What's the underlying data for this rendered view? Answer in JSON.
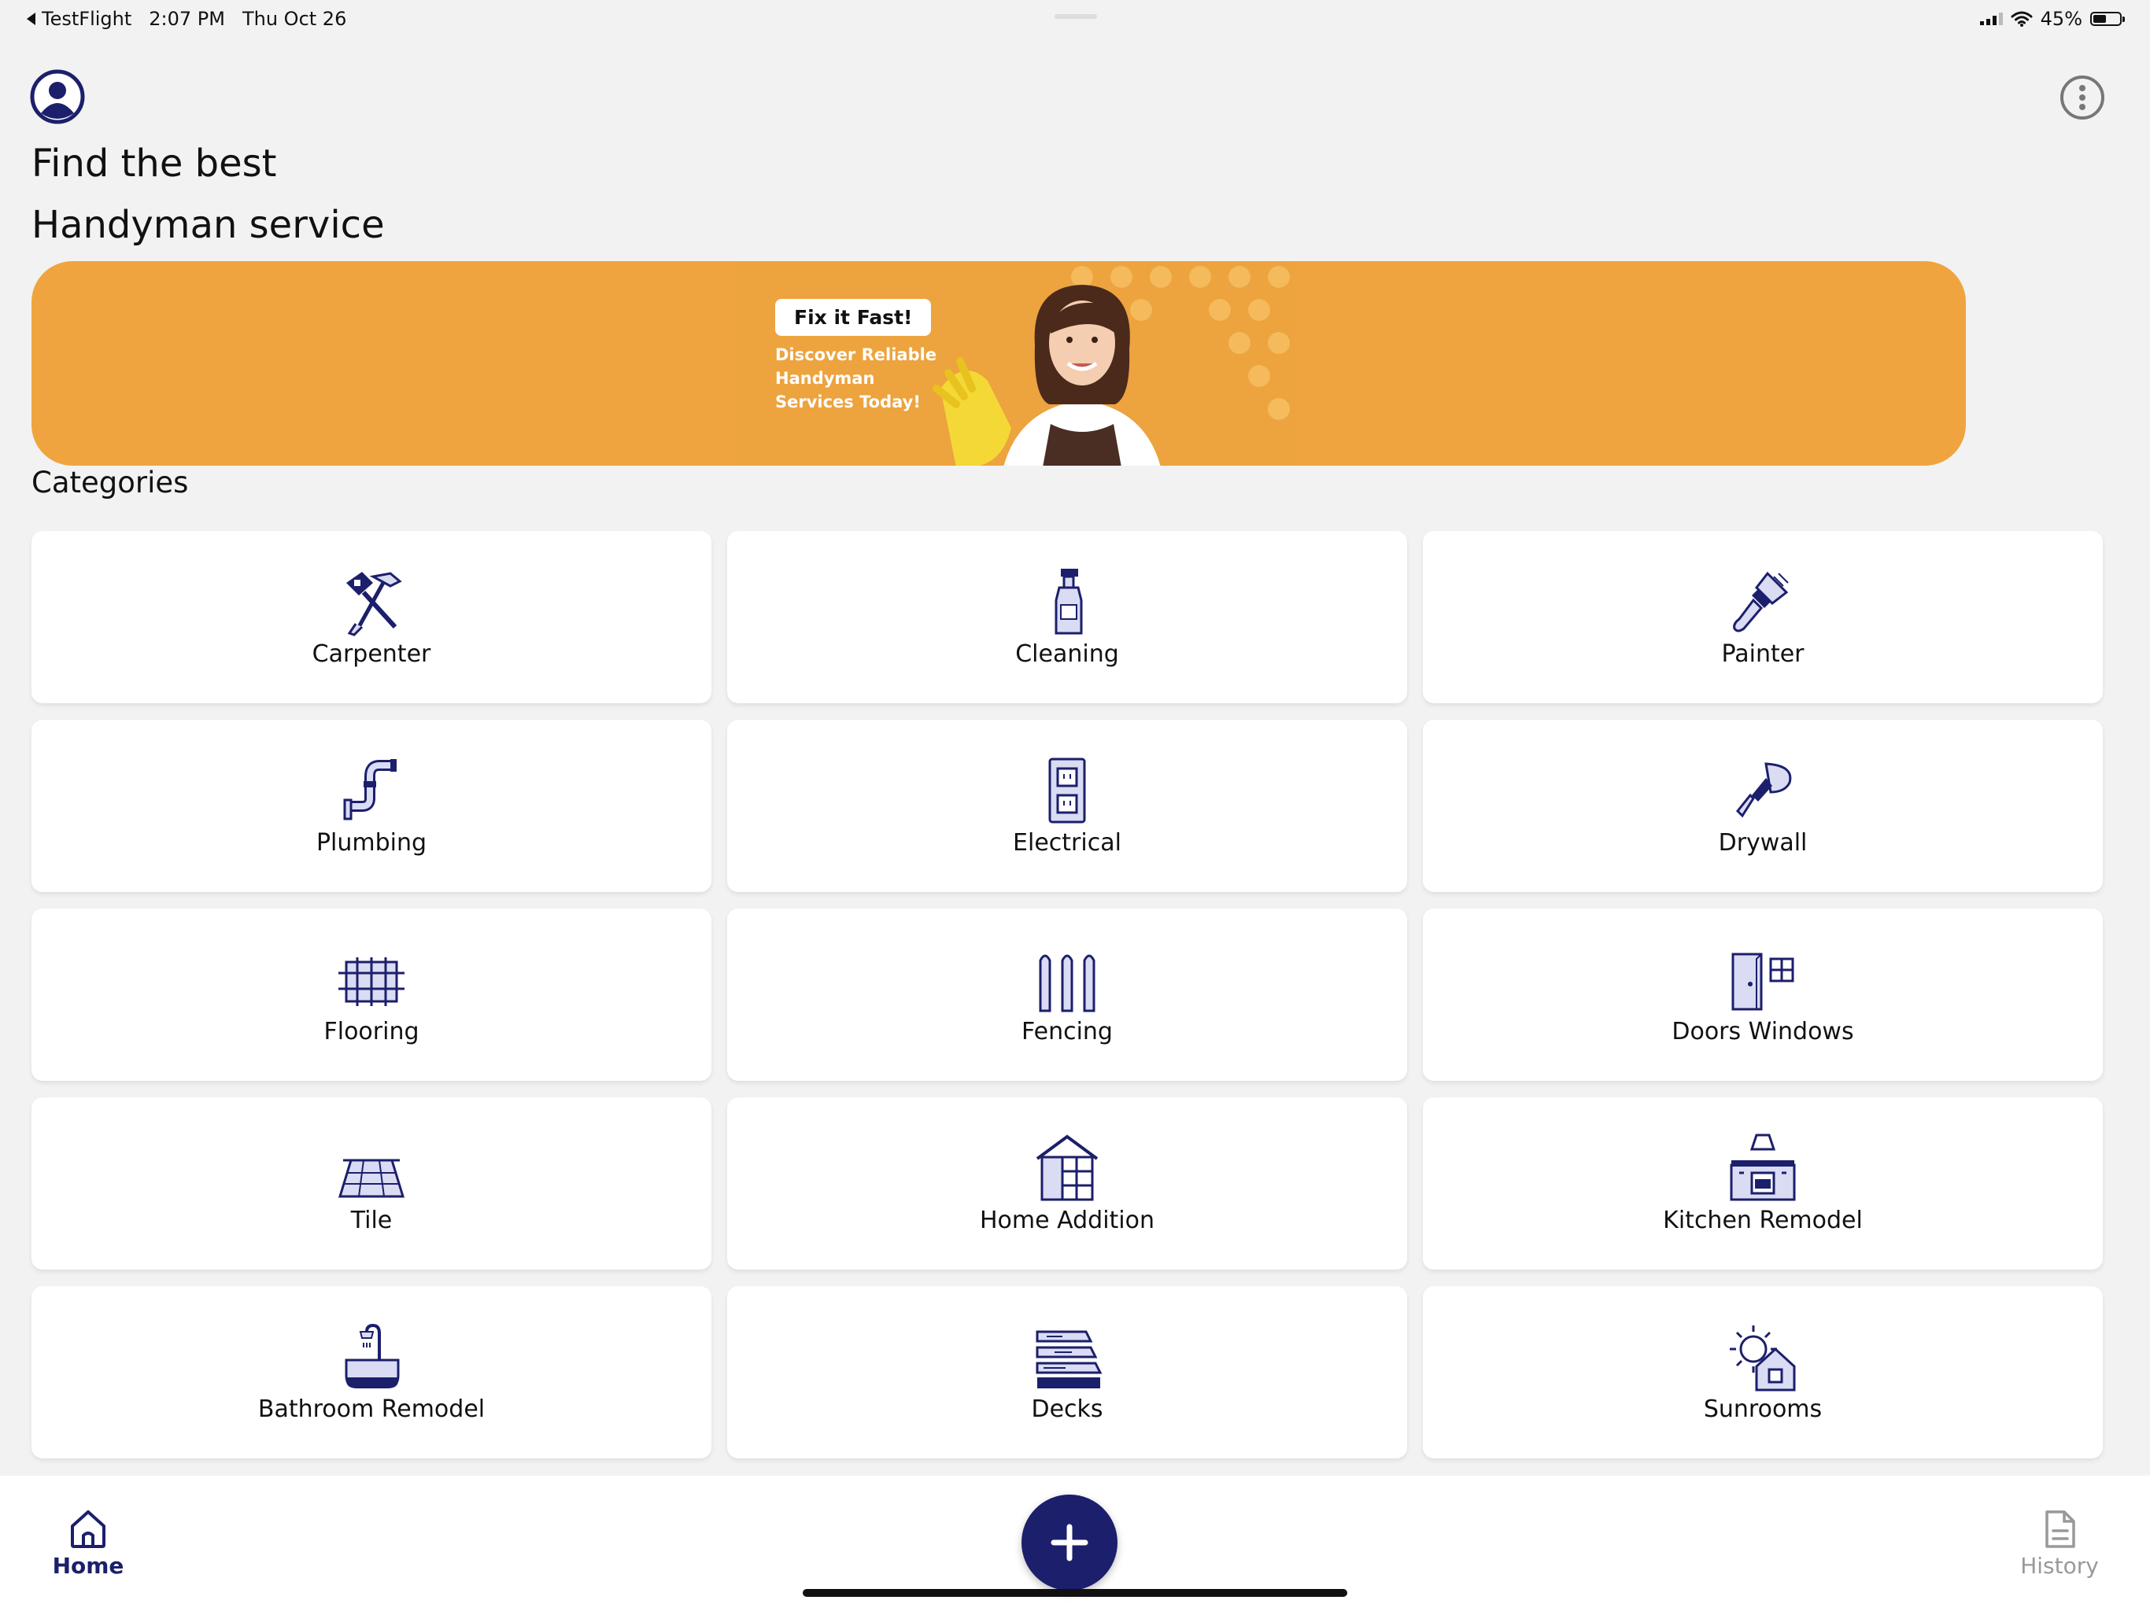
{
  "status_bar": {
    "back_app": "TestFlight",
    "time": "2:07 PM",
    "date": "Thu Oct 26",
    "battery": "45%"
  },
  "header": {
    "line1": "Find the best",
    "line2": "Handyman service"
  },
  "banner": {
    "pill": "Fix it Fast!",
    "subtitle": "Discover Reliable Handyman Services Today!"
  },
  "categories": {
    "title": "Categories",
    "items": [
      {
        "label": "Carpenter",
        "icon": "carpenter-icon"
      },
      {
        "label": "Cleaning",
        "icon": "cleaning-spray-icon"
      },
      {
        "label": "Painter",
        "icon": "paint-brush-icon"
      },
      {
        "label": "Plumbing",
        "icon": "pipe-icon"
      },
      {
        "label": "Electrical",
        "icon": "outlet-icon"
      },
      {
        "label": "Drywall",
        "icon": "putty-knife-icon"
      },
      {
        "label": "Flooring",
        "icon": "flooring-icon"
      },
      {
        "label": "Fencing",
        "icon": "fence-icon"
      },
      {
        "label": "Doors Windows",
        "icon": "door-window-icon"
      },
      {
        "label": "Tile",
        "icon": "tile-icon"
      },
      {
        "label": "Home Addition",
        "icon": "house-addition-icon"
      },
      {
        "label": "Kitchen Remodel",
        "icon": "kitchen-icon"
      },
      {
        "label": "Bathroom Remodel",
        "icon": "bathtub-icon"
      },
      {
        "label": "Decks",
        "icon": "deck-icon"
      },
      {
        "label": "Sunrooms",
        "icon": "sunroom-icon"
      }
    ]
  },
  "tabbar": {
    "home": "Home",
    "history": "History"
  },
  "colors": {
    "accent": "#1c1f6b",
    "banner": "#f0a43f",
    "icon_fill": "#d9dcf3"
  }
}
